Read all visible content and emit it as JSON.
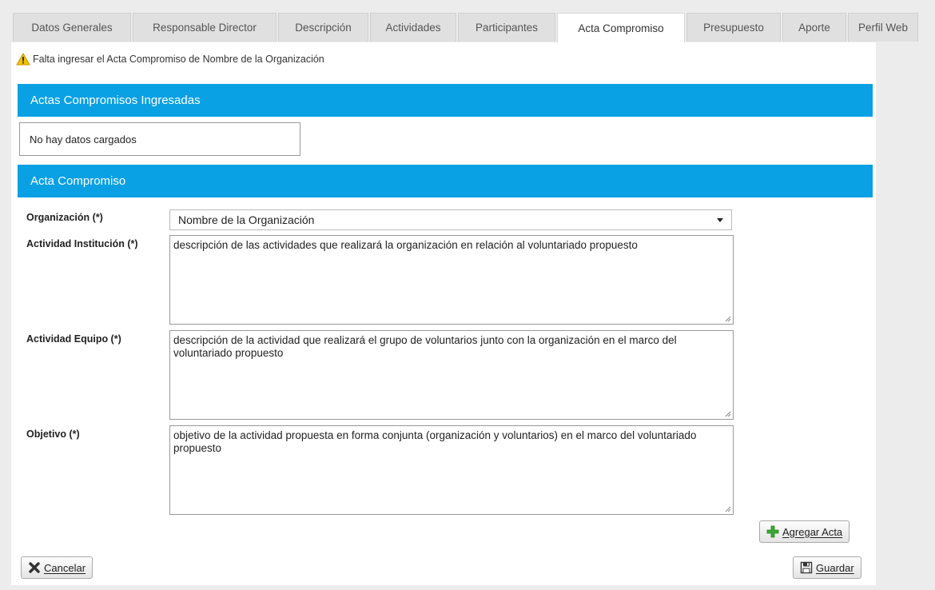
{
  "tabs": [
    {
      "label": "Datos Generales",
      "active": false
    },
    {
      "label": "Responsable Director",
      "active": false
    },
    {
      "label": "Descripción",
      "active": false
    },
    {
      "label": "Actividades",
      "active": false
    },
    {
      "label": "Participantes",
      "active": false
    },
    {
      "label": "Acta Compromiso",
      "active": true
    },
    {
      "label": "Presupuesto",
      "active": false
    },
    {
      "label": "Aporte",
      "active": false
    },
    {
      "label": "Perfil Web",
      "active": false
    }
  ],
  "warning": {
    "icon": "warning-icon",
    "text": "Falta ingresar el Acta Compromiso de Nombre de la Organización"
  },
  "actas_ingresadas": {
    "title": "Actas Compromisos Ingresadas",
    "empty_text": "No hay datos cargados"
  },
  "acta_form": {
    "title": "Acta Compromiso",
    "organizacion": {
      "label": "Organización (*)",
      "value": "Nombre de la Organización"
    },
    "actividad_institucion": {
      "label": "Actividad Institución (*)",
      "value": "descripción de las actividades que realizará la organización en relación al voluntariado propuesto"
    },
    "actividad_equipo": {
      "label": "Actividad Equipo (*)",
      "value": "descripción de la actividad que realizará el grupo de voluntarios junto con la organización en el marco del voluntariado propuesto"
    },
    "objetivo": {
      "label": "Objetivo (*)",
      "value": "objetivo de la actividad propuesta en forma conjunta (organización y voluntarios) en el marco del voluntariado propuesto"
    }
  },
  "buttons": {
    "agregar": {
      "label": "Agregar Acta",
      "icon": "plus-icon",
      "color": "#3aa832"
    },
    "cancelar": {
      "label": "Cancelar",
      "icon": "close-icon"
    },
    "guardar": {
      "label": "Guardar",
      "icon": "save-icon"
    }
  },
  "colors": {
    "section_header": "#0aa0e4",
    "warning": "#f2c200"
  }
}
